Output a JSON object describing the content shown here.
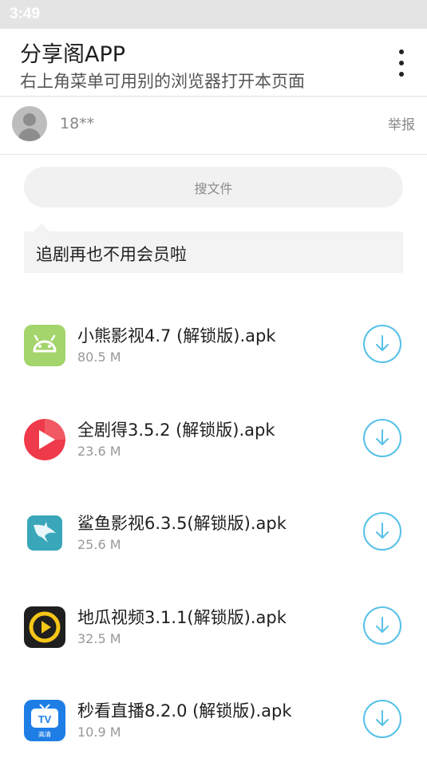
{
  "status_bar": {
    "time": "3:49"
  },
  "app_bar": {
    "title": "分享阁APP",
    "subtitle": "右上角菜单可用别的浏览器打开本页面"
  },
  "user": {
    "name": "18**",
    "report_label": "举报"
  },
  "search": {
    "label": "搜文件"
  },
  "notice": {
    "text": "追剧再也不用会员啦"
  },
  "files": [
    {
      "name": "小熊影视4.7 (解锁版).apk",
      "size": "80.5 M",
      "icon": "android-icon",
      "icon_color": "#a4d46c"
    },
    {
      "name": "全剧得3.5.2 (解锁版).apk",
      "size": "23.6 M",
      "icon": "play-icon",
      "icon_color": "#ee3a4a"
    },
    {
      "name": "鲨鱼影视6.3.5(解锁版).apk",
      "size": "25.6 M",
      "icon": "shark-icon",
      "icon_color": "#3aa6b9"
    },
    {
      "name": "地瓜视频3.1.1(解锁版).apk",
      "size": "32.5 M",
      "icon": "video-play-icon",
      "icon_color": "#1f1f1f"
    },
    {
      "name": "秒看直播8.2.0 (解锁版).apk",
      "size": "10.9 M",
      "icon": "tv-icon",
      "icon_color": "#1e7ee6",
      "icon_text_top": "TV",
      "icon_text_bottom": "高清"
    }
  ],
  "colors": {
    "accent": "#57c1e8",
    "status_bar": "#e4e4e4"
  }
}
